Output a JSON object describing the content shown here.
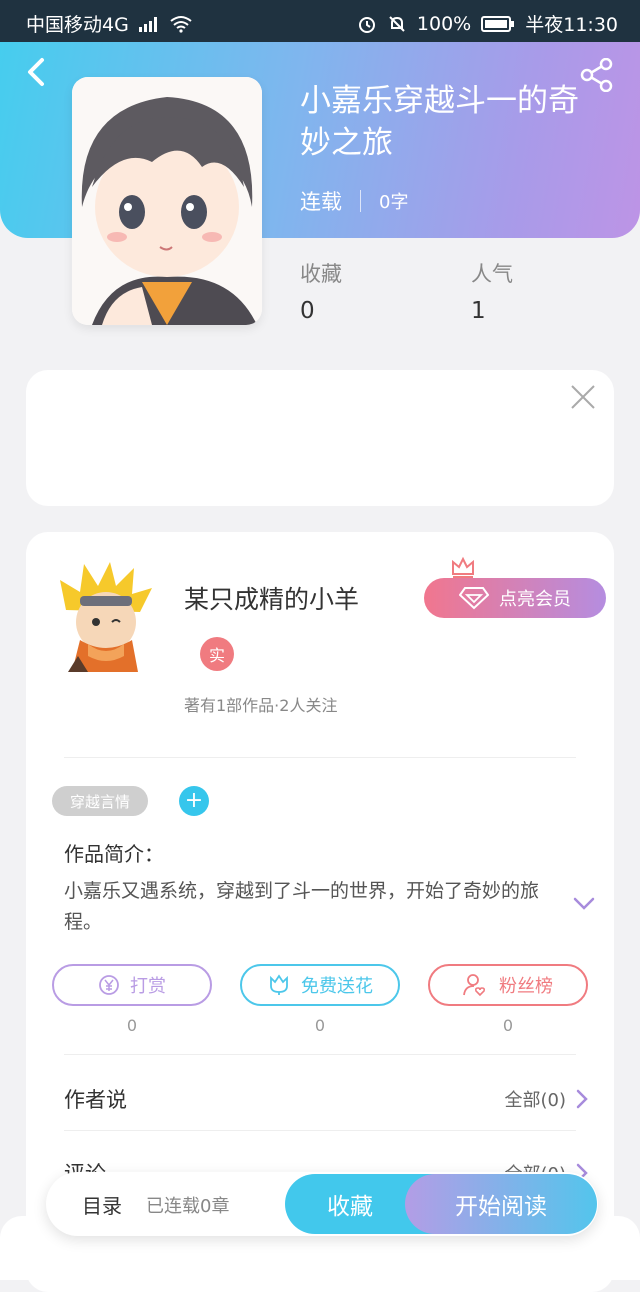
{
  "status_bar": {
    "carrier": "中国移动4G",
    "signal_label": "4G",
    "battery": "100%",
    "time": "半夜11:30"
  },
  "book": {
    "title": "小嘉乐穿越斗一的奇妙之旅",
    "status": "连载",
    "word_count": "0字",
    "favorites_label": "收藏",
    "favorites_value": "0",
    "popularity_label": "人气",
    "popularity_value": "1"
  },
  "author": {
    "name": "某只成精的小羊",
    "real_badge": "实",
    "stats": "著有1部作品·2人关注",
    "vip_button": "点亮会员"
  },
  "tags": {
    "genre": "穿越言情",
    "add": "+"
  },
  "intro": {
    "label": "作品简介：",
    "text": "小嘉乐又遇系统，穿越到了斗一的世界，开始了奇妙的旅程。"
  },
  "actions": [
    {
      "label": "打赏",
      "count": "0",
      "color": "#b99ce4"
    },
    {
      "label": "免费送花",
      "count": "0",
      "color": "#4cc7ea"
    },
    {
      "label": "粉丝榜",
      "count": "0",
      "color": "#f07b80"
    }
  ],
  "rows": {
    "author_says": {
      "label": "作者说",
      "right": "全部(0)"
    },
    "comments": {
      "label": "评论",
      "right": "全部(0)"
    }
  },
  "bottom_bar": {
    "toc": "目录",
    "chapters": "已连载0章",
    "favorite": "收藏",
    "read": "开始阅读"
  },
  "colors": {
    "accent_blue": "#42c8ec",
    "accent_purple": "#b58de0",
    "accent_red": "#f07b80"
  }
}
